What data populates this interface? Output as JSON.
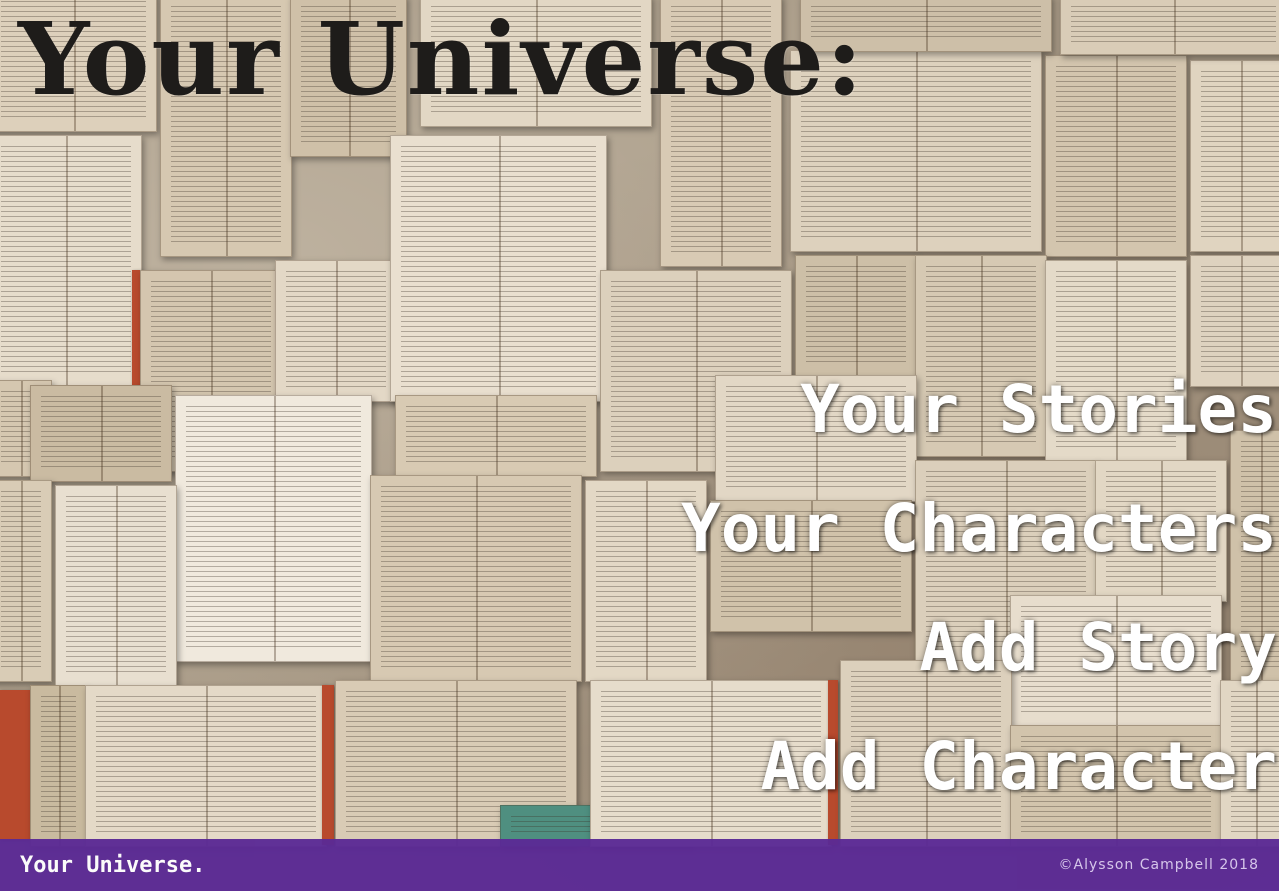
{
  "header": {
    "title": "Your Universe:"
  },
  "menu": {
    "items": [
      {
        "label": "Your Stories"
      },
      {
        "label": "Your Characters"
      },
      {
        "label": "Add Story"
      },
      {
        "label": "Add Character"
      }
    ]
  },
  "footer": {
    "brand": "Your Universe.",
    "credit": "©Alysson Campbell 2018"
  },
  "colors": {
    "footer_bg": "#5b2a95",
    "title_text": "#1e1c1a",
    "menu_text": "#ffffff"
  }
}
